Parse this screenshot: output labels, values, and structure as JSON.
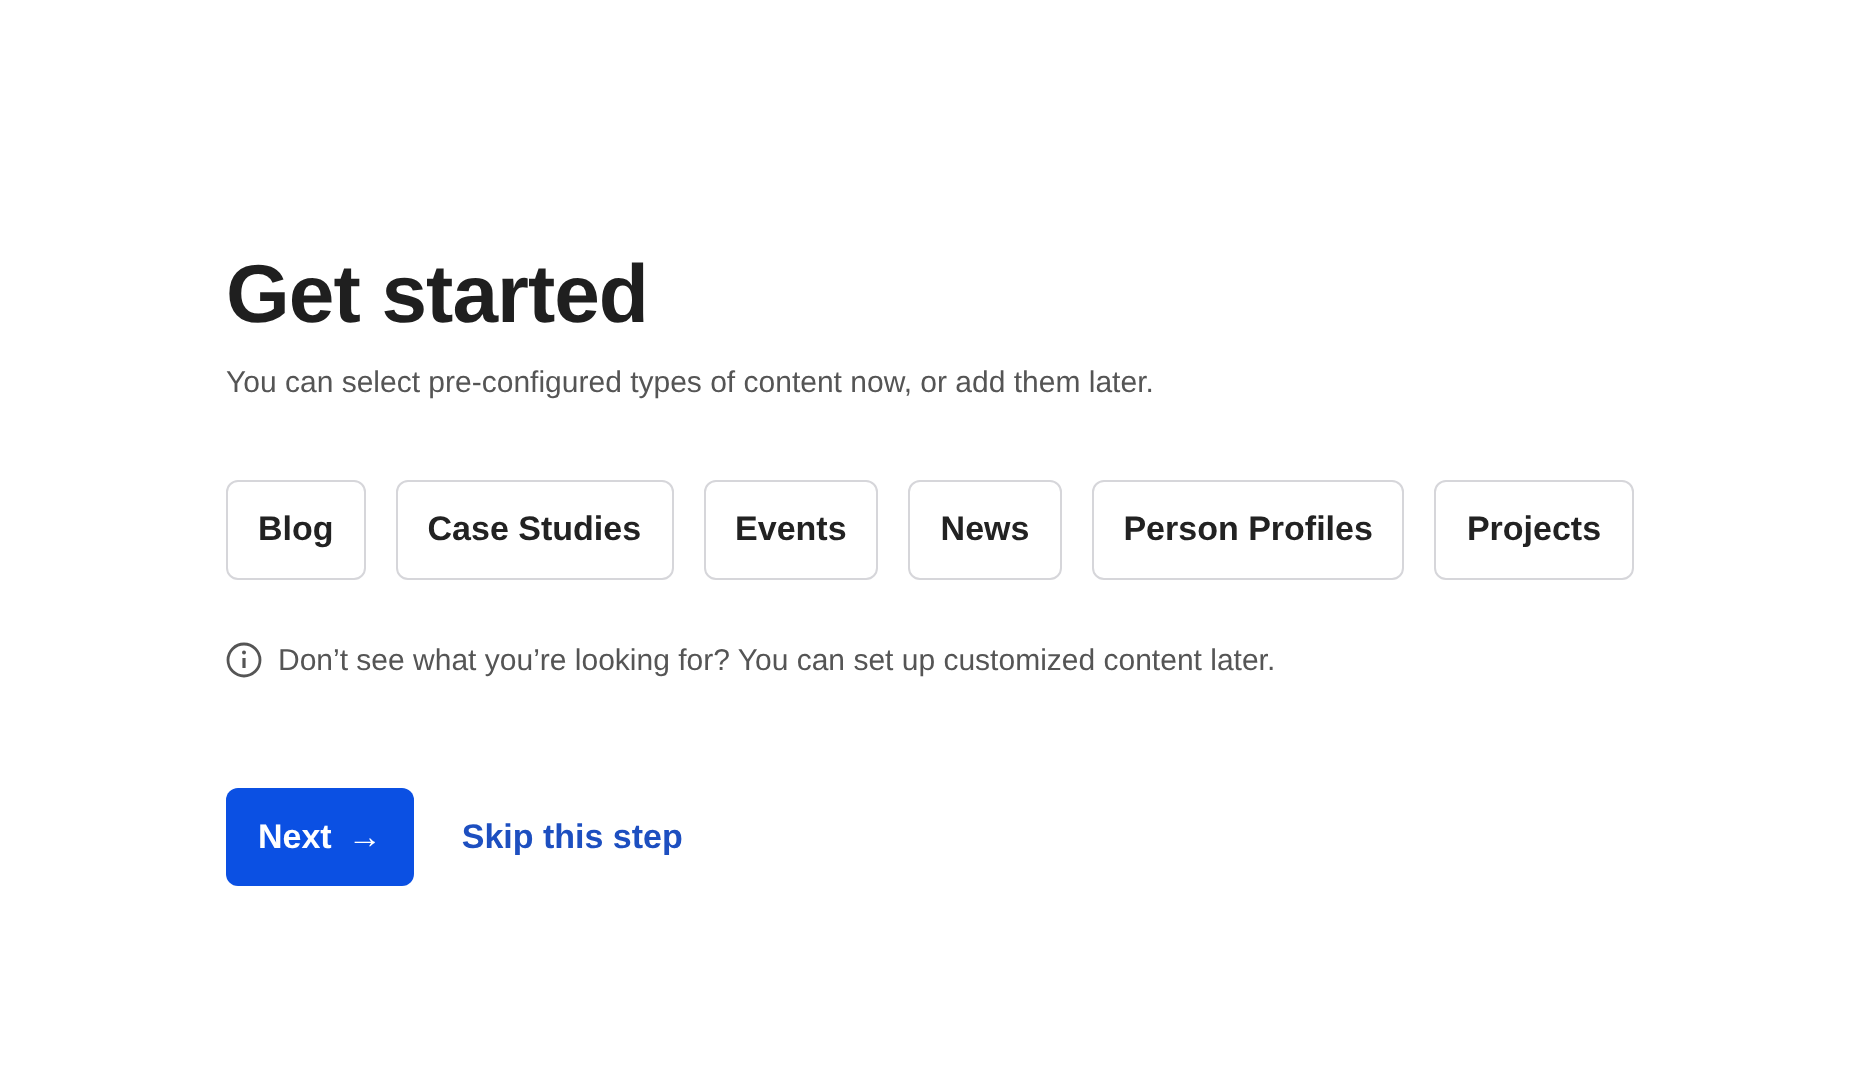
{
  "heading": "Get started",
  "subtitle": "You can select pre-configured types of content now, or add them later.",
  "content_types": [
    {
      "label": "Blog"
    },
    {
      "label": "Case Studies"
    },
    {
      "label": "Events"
    },
    {
      "label": "News"
    },
    {
      "label": "Person Profiles"
    },
    {
      "label": "Projects"
    }
  ],
  "info": "Don’t see what you’re looking for? You can set up customized content later.",
  "primary_button": {
    "label": "Next",
    "arrow": "→"
  },
  "skip_link": "Skip this step"
}
